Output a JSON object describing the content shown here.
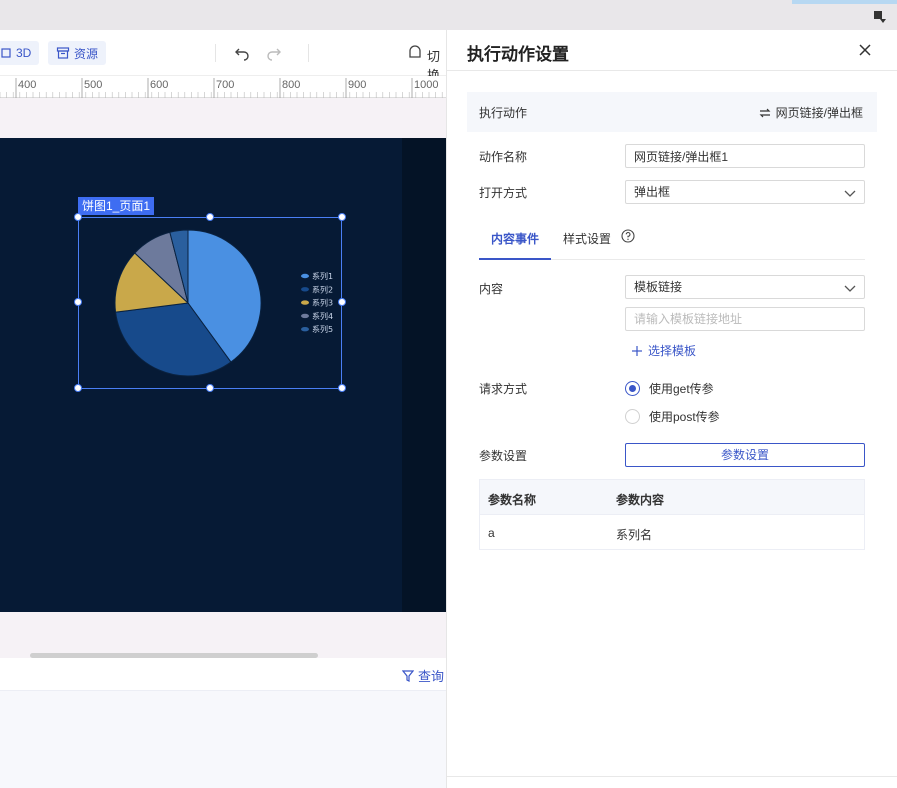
{
  "toolbar": {
    "btn_3d_label": "3D",
    "btn_resource_label": "资源",
    "switch_label": "切换"
  },
  "ruler": {
    "ticks": [
      "400",
      "500",
      "600",
      "700",
      "800",
      "900",
      "1000"
    ]
  },
  "canvas": {
    "component_tag": "饼图1_页面1"
  },
  "bottom": {
    "query_label": "查询"
  },
  "chart_data": {
    "type": "pie",
    "series": [
      {
        "name": "系列1",
        "value": 40,
        "color": "#4a90e2"
      },
      {
        "name": "系列2",
        "value": 33,
        "color": "#174a8b"
      },
      {
        "name": "系列3",
        "value": 14,
        "color": "#c9a84a"
      },
      {
        "name": "系列4",
        "value": 9,
        "color": "#6d7a9c"
      },
      {
        "name": "系列5",
        "value": 4,
        "color": "#2a5f9e"
      }
    ],
    "legend_position": "right"
  },
  "panel": {
    "title": "执行动作设置",
    "action": {
      "label": "执行动作",
      "value": "网页链接/弹出框"
    },
    "form": {
      "name_label": "动作名称",
      "name_value": "网页链接/弹出框1",
      "open_mode_label": "打开方式",
      "open_mode_value": "弹出框"
    },
    "tabs": {
      "content_events": "内容事件",
      "style_settings": "样式设置"
    },
    "content": {
      "label": "内容",
      "type_value": "模板链接",
      "link_placeholder": "请输入模板链接地址",
      "select_template": "选择模板"
    },
    "request": {
      "label": "请求方式",
      "option_get": "使用get传参",
      "option_post": "使用post传参",
      "selected": "get"
    },
    "params": {
      "label": "参数设置",
      "button_label": "参数设置",
      "columns": [
        "参数名称",
        "参数内容"
      ],
      "rows": [
        {
          "name": "a",
          "content": "系列名"
        }
      ]
    }
  },
  "colors": {
    "accent": "#3a56c8",
    "canvas_bg": "#061a35",
    "selection": "#4a7ff5"
  }
}
